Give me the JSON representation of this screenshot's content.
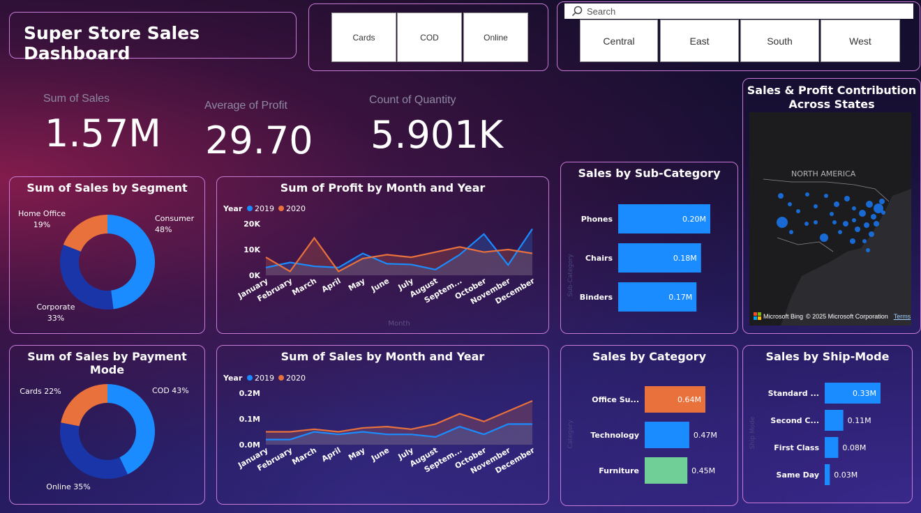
{
  "header": {
    "title": "Super Store Sales Dashboard"
  },
  "slicers": {
    "payment": [
      "Cards",
      "COD",
      "Online"
    ],
    "search_placeholder": "Search",
    "regions": [
      "Central",
      "East",
      "South",
      "West"
    ]
  },
  "kpis": [
    {
      "label": "Sum of Sales",
      "value": "1.57M"
    },
    {
      "label": "Average of Profit",
      "value": "29.70"
    },
    {
      "label": "Count of Quantity",
      "value": "5.901K"
    }
  ],
  "map": {
    "title_line1": "Sales & Profit Contribution",
    "title_line2": "Across States",
    "region_label": "NORTH AMERICA",
    "attribution": "Microsoft Bing",
    "copyright": "© 2025 Microsoft Corporation",
    "terms": "Terms",
    "bubble_color": "#1a73e8"
  },
  "colors": {
    "y2019": "#1a8cff",
    "y2020": "#e8713c",
    "dark_blue": "#1a35a8",
    "green": "#6fcf97"
  },
  "chart_data": [
    {
      "type": "pie",
      "title": "Sum of Sales by Segment",
      "categories": [
        "Consumer",
        "Corporate",
        "Home Office"
      ],
      "values": [
        48,
        33,
        19
      ],
      "labels": [
        "Consumer\n48%",
        "Corporate\n33%",
        "Home Office\n19%"
      ],
      "colors": [
        "#1a8cff",
        "#1a35a8",
        "#e8713c"
      ]
    },
    {
      "type": "area",
      "title": "Sum of Profit by Month and Year",
      "legend_title": "Year",
      "xlabel": "Month",
      "categories": [
        "January",
        "February",
        "March",
        "April",
        "May",
        "June",
        "July",
        "August",
        "Septem...",
        "October",
        "November",
        "December"
      ],
      "series": [
        {
          "name": "2019",
          "values": [
            3000,
            5000,
            3500,
            3000,
            8500,
            4500,
            4200,
            2200,
            8000,
            16000,
            4000,
            18000
          ]
        },
        {
          "name": "2020",
          "values": [
            7000,
            1500,
            14500,
            1500,
            6500,
            8000,
            7000,
            9000,
            11000,
            9000,
            10000,
            8500
          ]
        }
      ],
      "ytick_labels": [
        "0K",
        "10K",
        "20K"
      ],
      "ylim": [
        0,
        20000
      ]
    },
    {
      "type": "pie",
      "title": "Sum of Sales by Payment Mode",
      "categories": [
        "COD",
        "Online",
        "Cards"
      ],
      "values": [
        43,
        35,
        22
      ],
      "labels": [
        "COD 43%",
        "Online 35%",
        "Cards 22%"
      ],
      "colors": [
        "#1a8cff",
        "#1a35a8",
        "#e8713c"
      ]
    },
    {
      "type": "area",
      "title": "Sum of Sales by Month and Year",
      "legend_title": "Year",
      "categories": [
        "January",
        "February",
        "March",
        "April",
        "May",
        "June",
        "July",
        "August",
        "Septem...",
        "October",
        "November",
        "December"
      ],
      "series": [
        {
          "name": "2019",
          "values": [
            0.02,
            0.02,
            0.05,
            0.04,
            0.05,
            0.04,
            0.04,
            0.03,
            0.07,
            0.04,
            0.08,
            0.08
          ]
        },
        {
          "name": "2020",
          "values": [
            0.05,
            0.05,
            0.06,
            0.05,
            0.065,
            0.07,
            0.06,
            0.08,
            0.12,
            0.09,
            0.13,
            0.17
          ]
        }
      ],
      "ytick_labels": [
        "0.0M",
        "0.1M",
        "0.2M"
      ],
      "ylim": [
        0,
        0.2
      ]
    },
    {
      "type": "bar",
      "title": "Sales by Sub-Category",
      "ylabel": "Sub-Category",
      "categories": [
        "Phones",
        "Chairs",
        "Binders"
      ],
      "values": [
        0.2,
        0.18,
        0.17
      ],
      "value_labels": [
        "0.20M",
        "0.18M",
        "0.17M"
      ],
      "orientation": "horizontal"
    },
    {
      "type": "bar",
      "title": "Sales by Category",
      "ylabel": "Category",
      "categories": [
        "Office Su...",
        "Technology",
        "Furniture"
      ],
      "values": [
        0.64,
        0.47,
        0.45
      ],
      "value_labels": [
        "0.64M",
        "0.47M",
        "0.45M"
      ],
      "colors": [
        "#e8713c",
        "#1a8cff",
        "#6fcf97"
      ],
      "orientation": "horizontal"
    },
    {
      "type": "bar",
      "title": "Sales by Ship-Mode",
      "ylabel": "Ship Mode",
      "categories": [
        "Standard ...",
        "Second C...",
        "First Class",
        "Same Day"
      ],
      "values": [
        0.33,
        0.11,
        0.08,
        0.03
      ],
      "value_labels": [
        "0.33M",
        "0.11M",
        "0.08M",
        "0.03M"
      ],
      "orientation": "horizontal"
    }
  ]
}
